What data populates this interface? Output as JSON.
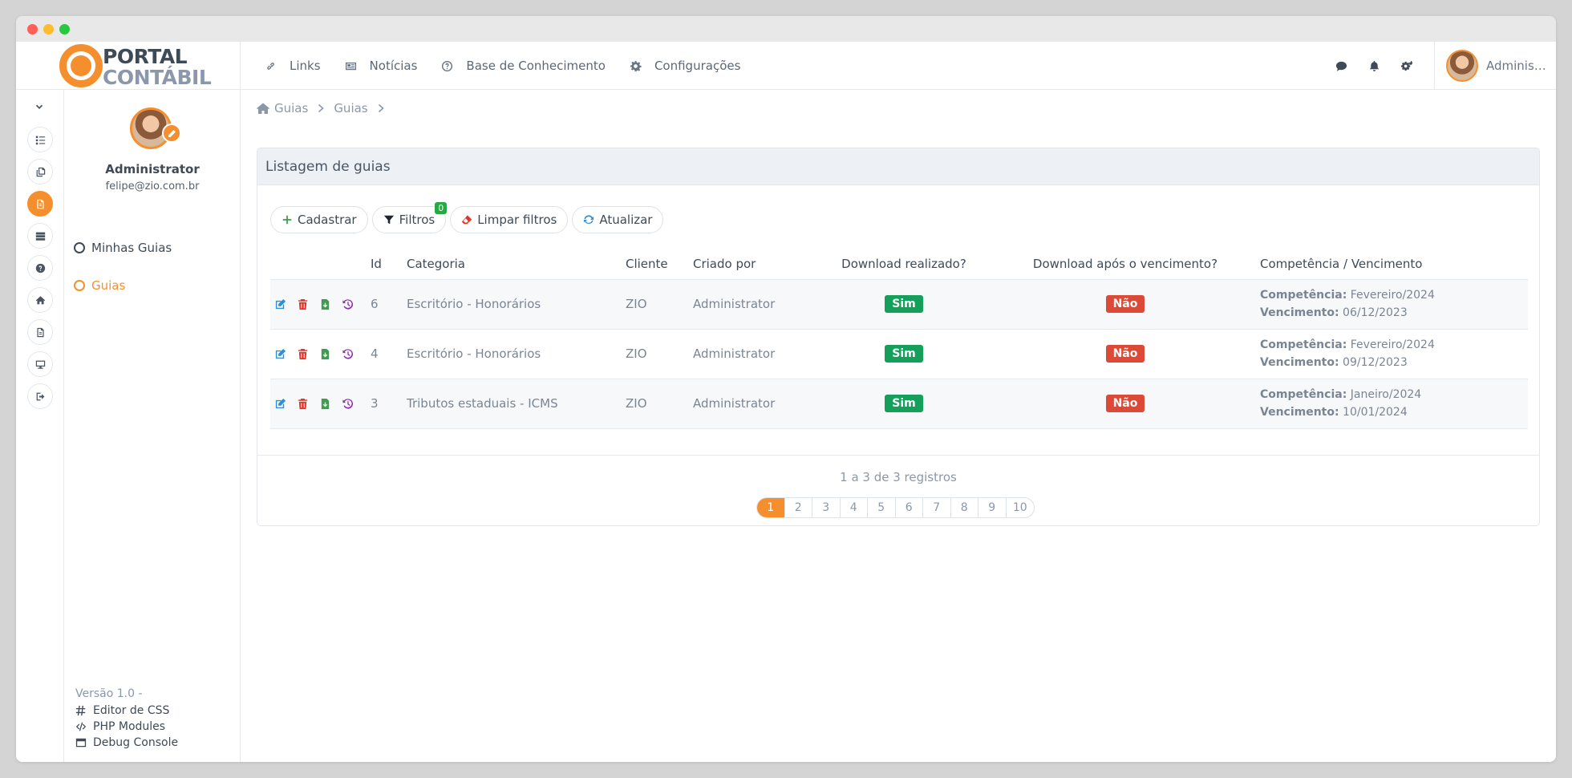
{
  "logo": {
    "line1": "PORTAL",
    "line2": "CONTÁBIL"
  },
  "topnav": [
    {
      "label": "Links",
      "icon": "link-icon"
    },
    {
      "label": "Notícias",
      "icon": "newspaper-icon"
    },
    {
      "label": "Base de Conhecimento",
      "icon": "question-circle-icon"
    },
    {
      "label": "Configurações",
      "icon": "gear-icon"
    }
  ],
  "header": {
    "user_name": "Administrator"
  },
  "sidebar": {
    "name": "Administrator",
    "email": "felipe@zio.com.br",
    "menu": [
      {
        "label": "Minhas Guias",
        "active": false
      },
      {
        "label": "Guias",
        "active": true
      }
    ],
    "version": "Versão 1.0 -",
    "links": [
      "Editor de CSS",
      "PHP Modules",
      "Debug Console"
    ]
  },
  "breadcrumb": [
    "Guias",
    "Guias"
  ],
  "card": {
    "title": "Listagem de guias"
  },
  "toolbar": {
    "add": "Cadastrar",
    "filters": "Filtros",
    "filters_count": "0",
    "clear": "Limpar filtros",
    "refresh": "Atualizar"
  },
  "table": {
    "columns": [
      "",
      "Id",
      "Categoria",
      "Cliente",
      "Criado por",
      "Download realizado?",
      "Download após o vencimento?",
      "Competência / Vencimento"
    ],
    "comp_label": "Competência:",
    "venc_label": "Vencimento:",
    "rows": [
      {
        "id": "6",
        "categoria": "Escritório - Honorários",
        "cliente": "ZIO",
        "criado_por": "Administrator",
        "download": "Sim",
        "download_apos": "Não",
        "competencia": "Fevereiro/2024",
        "vencimento": "06/12/2023"
      },
      {
        "id": "4",
        "categoria": "Escritório - Honorários",
        "cliente": "ZIO",
        "criado_por": "Administrator",
        "download": "Sim",
        "download_apos": "Não",
        "competencia": "Fevereiro/2024",
        "vencimento": "09/12/2023"
      },
      {
        "id": "3",
        "categoria": "Tributos estaduais - ICMS",
        "cliente": "ZIO",
        "criado_por": "Administrator",
        "download": "Sim",
        "download_apos": "Não",
        "competencia": "Janeiro/2024",
        "vencimento": "10/01/2024"
      }
    ]
  },
  "pagination": {
    "records": "1 a 3 de 3 registros",
    "pages": [
      "1",
      "2",
      "3",
      "4",
      "5",
      "6",
      "7",
      "8",
      "9",
      "10"
    ],
    "current": "1"
  },
  "colors": {
    "accent": "#f58f2e",
    "success": "#14a05a",
    "danger": "#dc4a37"
  }
}
